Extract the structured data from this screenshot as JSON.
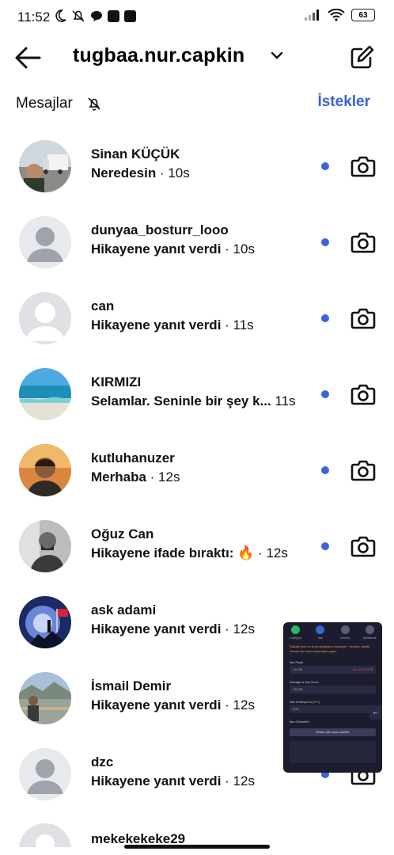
{
  "status_bar": {
    "time": "11:52",
    "battery": "63"
  },
  "header": {
    "account_name": "tugbaa.nur.capkin"
  },
  "section": {
    "title": "Mesajlar",
    "requests_label": "İstekler"
  },
  "threads": [
    {
      "name": "Sinan KÜÇÜK",
      "message": "Neredesin",
      "time": "10s"
    },
    {
      "name": "dunyaa_bosturr_looo",
      "message": "Hikayene yanıt verdi",
      "time": "10s"
    },
    {
      "name": "can",
      "message": "Hikayene yanıt verdi",
      "time": "11s"
    },
    {
      "name": "KIRMIZI",
      "message": "Selamlar. Seninle bir şey k...",
      "time": "11s"
    },
    {
      "name": "kutluhanuzer",
      "message": "Merhaba",
      "time": "12s"
    },
    {
      "name": "Oğuz Can",
      "message": "Hikayene ifade bıraktı: 🔥",
      "time": "12s"
    },
    {
      "name": "ask adami",
      "message": "Hikayene yanıt verdi",
      "time": "12s"
    },
    {
      "name": "İsmail Demir",
      "message": "Hikayene yanıt verdi",
      "time": "12s"
    },
    {
      "name": "dzc",
      "message": "Hikayene yanıt verdi",
      "time": "12s"
    }
  ],
  "partial_thread": {
    "name": "mekekekeke29"
  },
  "overlay": {
    "tabs": [
      "Kategori",
      "İlan",
      "Ürünler",
      "Belirtmek"
    ],
    "warning": "Dikkatli olun ve ürün detaylarını inceleyin. Yanıltıcı olabilir, ödeme için bizim üzerinden yapın.",
    "field1_label": "İlan Fiyatı",
    "field1_value": "123,55",
    "field1_error": "En az 10,00 ₺",
    "field2_label": "Alacağınız Net Ücret",
    "field2_value": "120,55",
    "field3_label": "Site Komisyonu (% 7)",
    "field3_value": "9,00",
    "section_label": "İlan Görselleri",
    "upload_button": "Resim yük veya sürükle"
  },
  "colors": {
    "accent": "#3b63d8",
    "unread_dot": "#3b63d8"
  }
}
